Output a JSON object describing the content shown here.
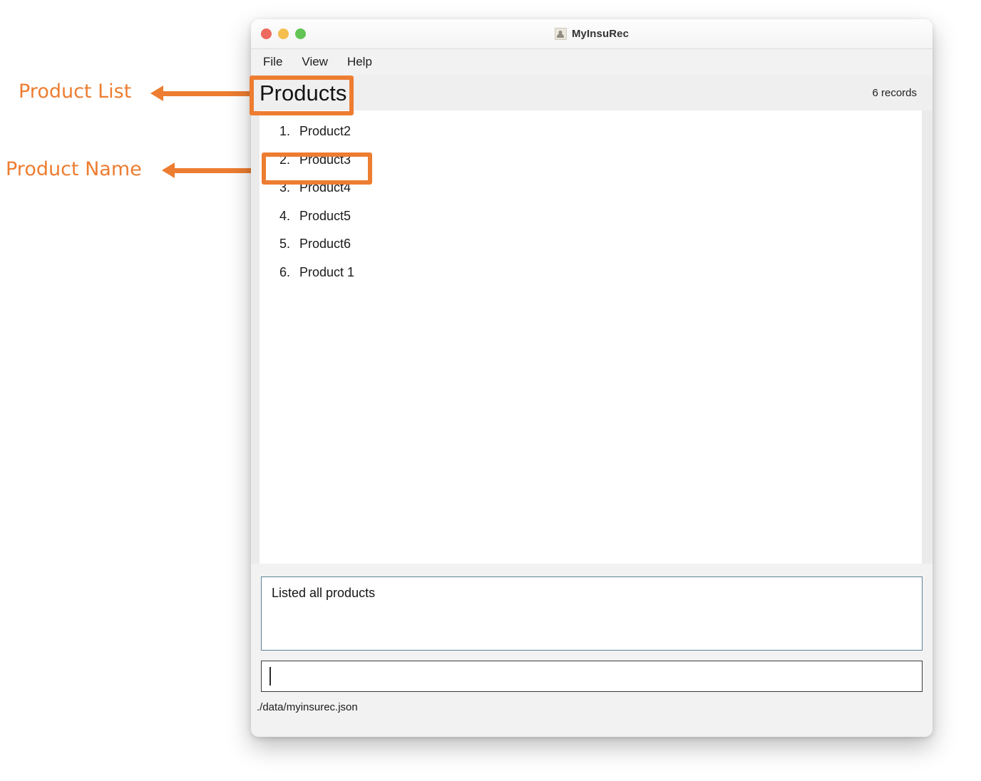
{
  "annotations": [
    {
      "label": "Product List",
      "target": "page-title"
    },
    {
      "label": "Product Name",
      "target": "list-item-2"
    }
  ],
  "window": {
    "title": "MyInsuRec",
    "app_icon": "person-card-icon",
    "traffic_lights": {
      "close": "#ed6a5e",
      "minimize": "#f4bf4f",
      "maximize": "#61c454"
    }
  },
  "menu": {
    "items": [
      {
        "label": "File"
      },
      {
        "label": "View"
      },
      {
        "label": "Help"
      }
    ]
  },
  "header": {
    "title": "Products",
    "record_count": "6 records"
  },
  "list": {
    "items": [
      {
        "index": "1.",
        "name": "Product2"
      },
      {
        "index": "2.",
        "name": "Product3"
      },
      {
        "index": "3.",
        "name": "Product4"
      },
      {
        "index": "4.",
        "name": "Product5"
      },
      {
        "index": "5.",
        "name": "Product6"
      },
      {
        "index": "6.",
        "name": "Product 1"
      }
    ]
  },
  "output": {
    "text": "Listed all products"
  },
  "command": {
    "value": "",
    "placeholder": ""
  },
  "status": {
    "file_path": "./data/myinsurec.json"
  },
  "colors": {
    "annotation_orange": "#ED7D31",
    "output_border": "#5d8296",
    "window_chrome": "#f2f2f2"
  }
}
